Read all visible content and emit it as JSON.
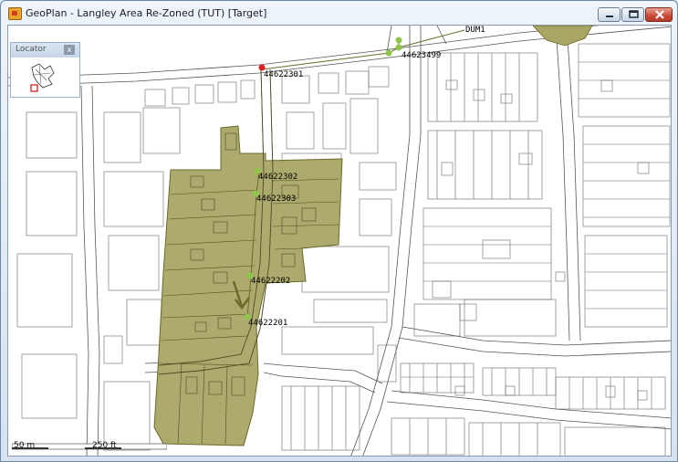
{
  "window": {
    "title": "GeoPlan - Langley Area Re-Zoned (TUT) [Target]",
    "controls": [
      "minimize",
      "maximize",
      "close"
    ]
  },
  "locator": {
    "title": "Locator",
    "close_label": "x"
  },
  "map": {
    "zone_color": "#a8a565",
    "zone_border": "#6b6a2a",
    "node_color": "#8fc54a",
    "selected_node_color": "#e02020",
    "node_labels": {
      "n1": "44622301",
      "n2": "44623499",
      "n3": "44622302",
      "n4": "44622303",
      "n5": "44622202",
      "n6": "44622201",
      "dum": "DUM1"
    }
  },
  "scalebar": {
    "label_left": "50 m",
    "label_right": "250 ft"
  }
}
